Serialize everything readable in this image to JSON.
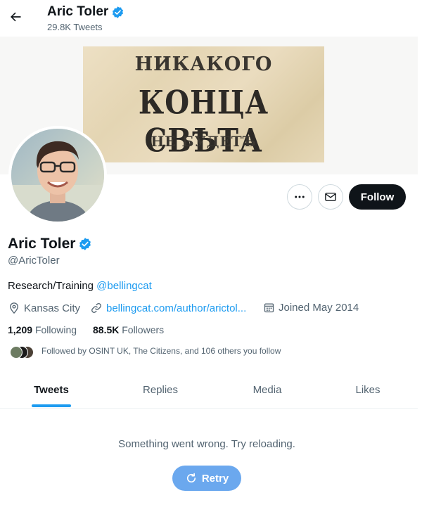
{
  "header": {
    "title": "Aric Toler",
    "tweet_count": "29.8K Tweets"
  },
  "banner": {
    "line1": "НИКАКОГО",
    "line2": "КОНЦА СВѢТА",
    "line3": "НЕ БУДЕТЪ"
  },
  "profile": {
    "display_name": "Aric Toler",
    "handle": "@AricToler",
    "bio_text": "Research/Training ",
    "bio_mention": "@bellingcat",
    "location": "Kansas City",
    "website": "bellingcat.com/author/arictol...",
    "joined": "Joined May 2014",
    "following_count": "1,209",
    "following_label": "Following",
    "followers_count": "88.5K",
    "followers_label": "Followers",
    "followed_by": "Followed by OSINT UK, The Citizens, and 106 others you follow"
  },
  "actions": {
    "follow_label": "Follow"
  },
  "tabs": [
    {
      "label": "Tweets",
      "active": true
    },
    {
      "label": "Replies",
      "active": false
    },
    {
      "label": "Media",
      "active": false
    },
    {
      "label": "Likes",
      "active": false
    }
  ],
  "timeline": {
    "error_message": "Something went wrong. Try reloading.",
    "retry_label": "Retry"
  },
  "colors": {
    "accent": "#1d9bf0",
    "follow_button": "#0f1419",
    "retry_button": "#6ba8ee",
    "secondary_text": "#536471"
  },
  "icons": [
    "back-arrow-icon",
    "verified-badge-icon",
    "more-icon",
    "message-icon",
    "location-icon",
    "link-icon",
    "calendar-icon",
    "refresh-icon"
  ]
}
